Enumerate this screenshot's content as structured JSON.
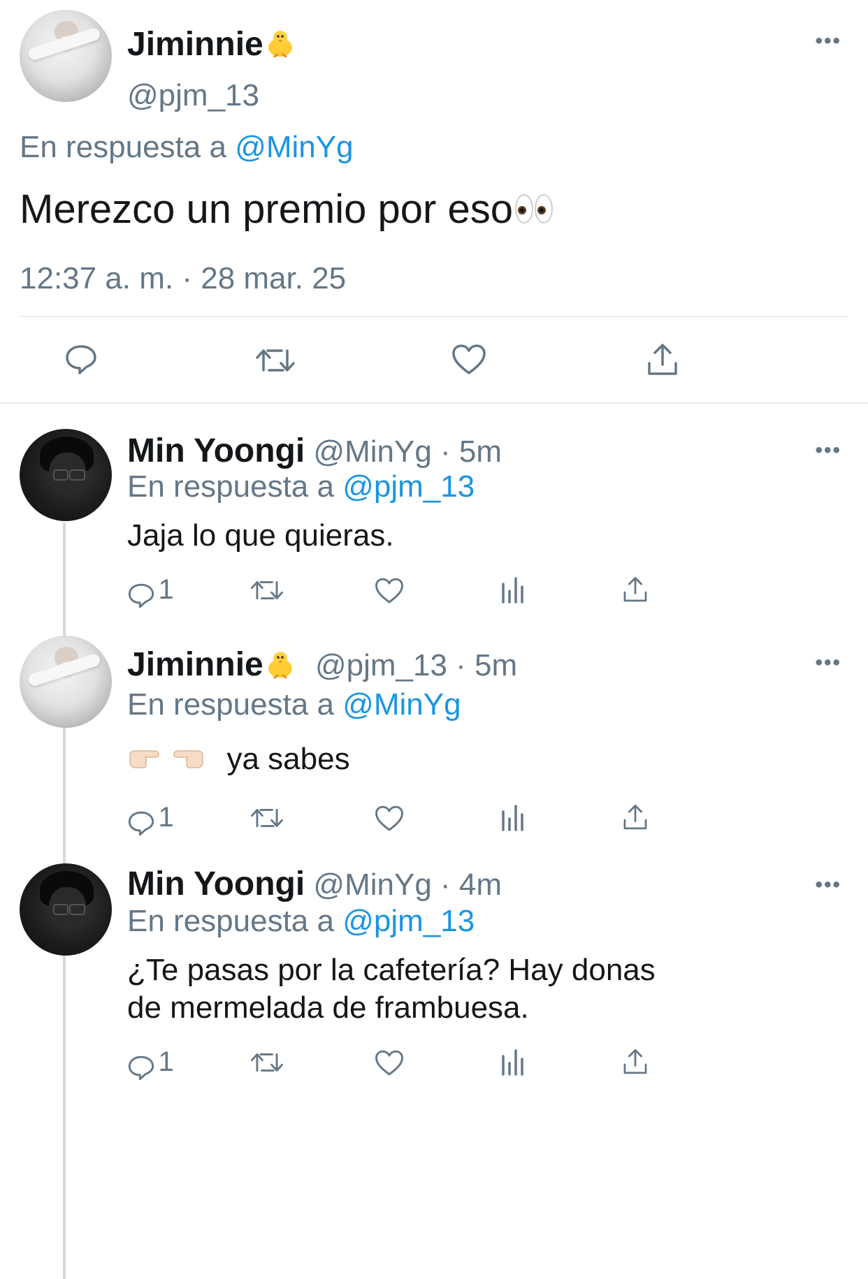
{
  "main_tweet": {
    "author_name": "Jiminnie",
    "author_handle": "@pjm_13",
    "reply_prefix": "En respuesta a",
    "reply_to": "@MinYg",
    "text": "Merezco un premio por eso",
    "timestamp": "12:37 a. m. · 28 mar. 25",
    "emoji": [
      "chick-icon",
      "eyes-icon"
    ]
  },
  "replies": [
    {
      "author_name": "Min Yoongi",
      "author_handle": "@MinYg",
      "time": "· 5m",
      "reply_prefix": "En respuesta a",
      "reply_to": "@pjm_13",
      "text": "Jaja lo que quieras.",
      "reply_count": "1"
    },
    {
      "author_name": "Jiminnie",
      "author_handle": "@pjm_13",
      "time": "· 5m",
      "reply_prefix": "En respuesta a",
      "reply_to": "@MinYg",
      "text": "ya sabes",
      "reply_count": "1",
      "emoji": [
        "pointing-right-hand-icon",
        "pointing-left-hand-icon"
      ]
    },
    {
      "author_name": "Min Yoongi",
      "author_handle": "@MinYg",
      "time": "· 4m",
      "reply_prefix": "En respuesta a",
      "reply_to": "@pjm_13",
      "text_line1": "¿Te pasas por la cafetería? Hay donas",
      "text_line2": "de mermelada de frambuesa.",
      "reply_count": "1"
    }
  ],
  "colors": {
    "link": "#1b95e0",
    "muted": "#657786",
    "text": "#14171a",
    "divider": "#e6ecf0"
  }
}
